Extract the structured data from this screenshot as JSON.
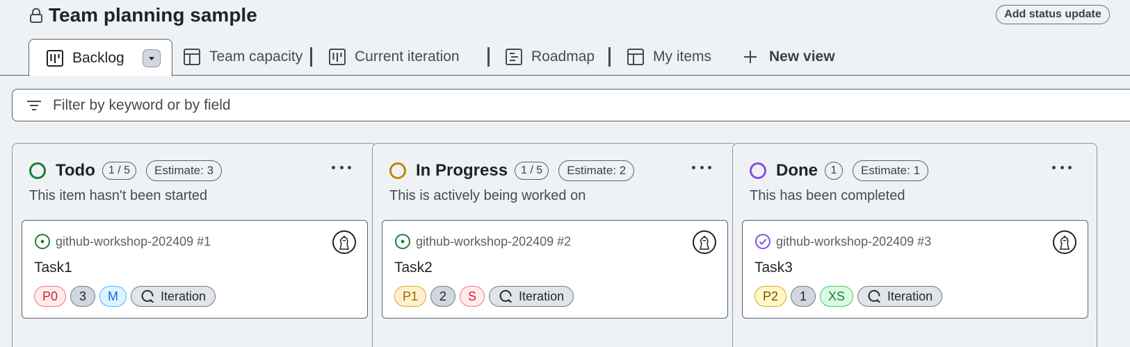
{
  "header": {
    "title": "Team planning sample",
    "add_status_update": "Add status update",
    "lock_icon": "lock-icon"
  },
  "tabs": [
    {
      "label": "Backlog",
      "icon": "board-icon",
      "active": true
    },
    {
      "label": "Team capacity",
      "icon": "table-icon"
    },
    {
      "label": "Current iteration",
      "icon": "board-icon"
    },
    {
      "label": "Roadmap",
      "icon": "roadmap-icon"
    },
    {
      "label": "My items",
      "icon": "table-icon"
    }
  ],
  "new_view": "New view",
  "filter": {
    "placeholder": "Filter by keyword or by field"
  },
  "colors": {
    "todo": "#1a7f37",
    "in_progress": "#bf8700",
    "done": "#8250df",
    "p0_bg": "#ffebe9",
    "p0_border": "#f0737c",
    "p0_text": "#cf222e",
    "p1_bg": "#fff1cc",
    "p1_border": "#d4a72c",
    "p1_text": "#9a6700",
    "p2_bg": "#fff8c5",
    "p2_border": "#d4a72c",
    "p2_text": "#7d4e00"
  },
  "columns": [
    {
      "name": "Todo",
      "count": "1 / 5",
      "estimate": "Estimate: 3",
      "description": "This item hasn't been started",
      "card": {
        "issue": "github-workshop-202409 #1",
        "title": "Task1",
        "priority": "P0",
        "points": "3",
        "size": "M",
        "iteration": "Iteration"
      }
    },
    {
      "name": "In Progress",
      "count": "1 / 5",
      "estimate": "Estimate: 2",
      "description": "This is actively being worked on",
      "card": {
        "issue": "github-workshop-202409 #2",
        "title": "Task2",
        "priority": "P1",
        "points": "2",
        "size": "S",
        "iteration": "Iteration"
      }
    },
    {
      "name": "Done",
      "count": "1",
      "estimate": "Estimate: 1",
      "description": "This has been completed",
      "card": {
        "issue": "github-workshop-202409 #3",
        "title": "Task3",
        "priority": "P2",
        "points": "1",
        "size": "XS",
        "iteration": "Iteration"
      }
    }
  ]
}
